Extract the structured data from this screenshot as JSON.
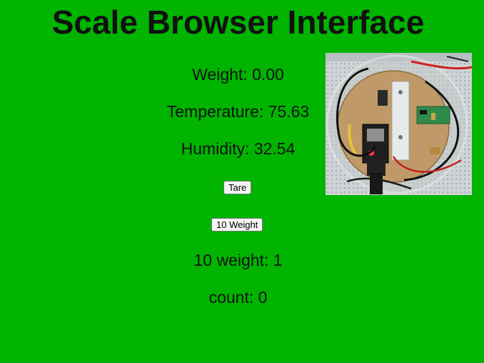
{
  "page": {
    "title": "Scale Browser Interface",
    "background_color": "#00b400"
  },
  "readings": {
    "weight": "Weight: 0.00",
    "temperature": "Temperature: 75.63",
    "humidity": "Humidity: 32.54",
    "ten_weight": "10 weight: 1",
    "count": "count: 0"
  },
  "buttons": {
    "tare": "Tare",
    "ten_weight": "10 Weight"
  },
  "photo": {
    "subject": "scale-hardware-photo"
  }
}
